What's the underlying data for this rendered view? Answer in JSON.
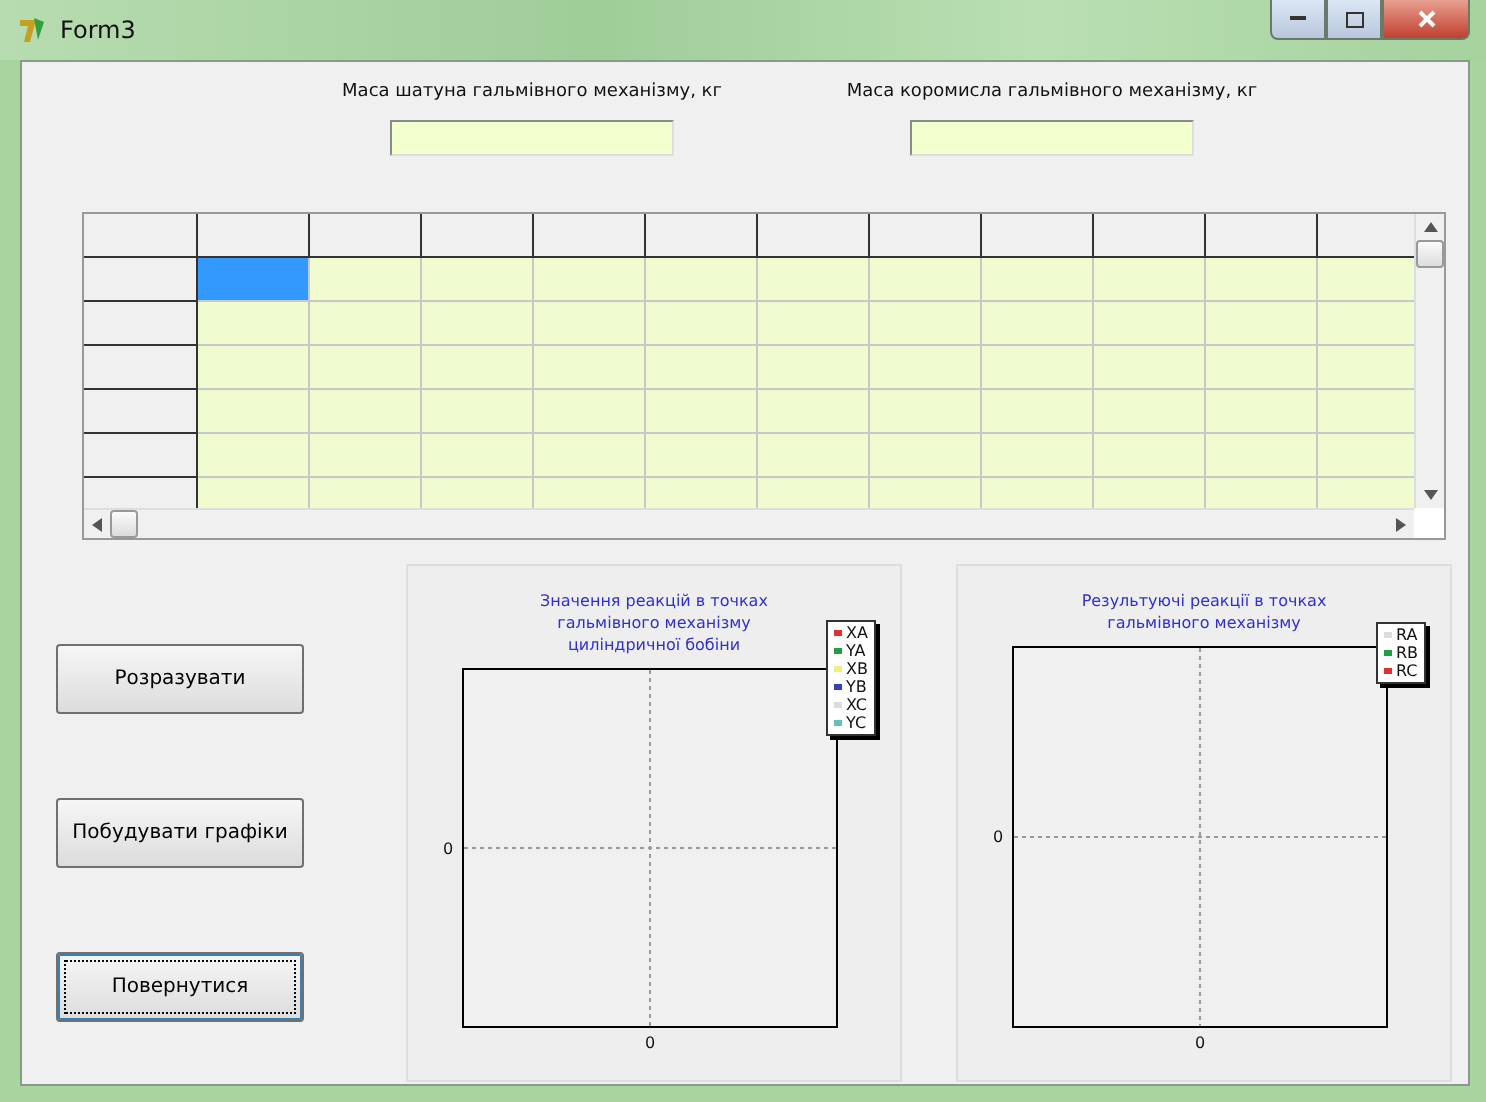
{
  "window": {
    "title": "Form3"
  },
  "fields": [
    {
      "label": "Маса шатуна гальмівного механізму, кг"
    },
    {
      "label": "Маса коромисла гальмівного механізму, кг"
    }
  ],
  "grid": {
    "header_cells": [
      {
        "selected": false
      },
      {
        "selected": false
      },
      {
        "selected": false
      },
      {
        "selected": false
      },
      {
        "selected": false
      },
      {
        "selected": false
      },
      {
        "selected": false
      },
      {
        "selected": false
      },
      {
        "selected": false
      },
      {
        "selected": false
      },
      {
        "selected": false
      }
    ],
    "rows": [
      {
        "cells": [
          {
            "selected": true
          },
          {
            "selected": false
          },
          {
            "selected": false
          },
          {
            "selected": false
          },
          {
            "selected": false
          },
          {
            "selected": false
          },
          {
            "selected": false
          },
          {
            "selected": false
          },
          {
            "selected": false
          },
          {
            "selected": false
          },
          {
            "selected": false
          }
        ]
      },
      {
        "cells": [
          {
            "selected": false
          },
          {
            "selected": false
          },
          {
            "selected": false
          },
          {
            "selected": false
          },
          {
            "selected": false
          },
          {
            "selected": false
          },
          {
            "selected": false
          },
          {
            "selected": false
          },
          {
            "selected": false
          },
          {
            "selected": false
          },
          {
            "selected": false
          }
        ]
      },
      {
        "cells": [
          {
            "selected": false
          },
          {
            "selected": false
          },
          {
            "selected": false
          },
          {
            "selected": false
          },
          {
            "selected": false
          },
          {
            "selected": false
          },
          {
            "selected": false
          },
          {
            "selected": false
          },
          {
            "selected": false
          },
          {
            "selected": false
          },
          {
            "selected": false
          }
        ]
      },
      {
        "cells": [
          {
            "selected": false
          },
          {
            "selected": false
          },
          {
            "selected": false
          },
          {
            "selected": false
          },
          {
            "selected": false
          },
          {
            "selected": false
          },
          {
            "selected": false
          },
          {
            "selected": false
          },
          {
            "selected": false
          },
          {
            "selected": false
          },
          {
            "selected": false
          }
        ]
      },
      {
        "cells": [
          {
            "selected": false
          },
          {
            "selected": false
          },
          {
            "selected": false
          },
          {
            "selected": false
          },
          {
            "selected": false
          },
          {
            "selected": false
          },
          {
            "selected": false
          },
          {
            "selected": false
          },
          {
            "selected": false
          },
          {
            "selected": false
          },
          {
            "selected": false
          }
        ]
      },
      {
        "cells": [
          {
            "selected": false
          },
          {
            "selected": false
          },
          {
            "selected": false
          },
          {
            "selected": false
          },
          {
            "selected": false
          },
          {
            "selected": false
          },
          {
            "selected": false
          },
          {
            "selected": false
          },
          {
            "selected": false
          },
          {
            "selected": false
          },
          {
            "selected": false
          }
        ]
      }
    ]
  },
  "buttons": [
    {
      "label": "Розразувати",
      "focused": false
    },
    {
      "label": "Побудувати графіки",
      "focused": false
    },
    {
      "label": "Повернутися",
      "focused": true
    }
  ],
  "charts": [
    {
      "title": "Значення реакцій в точках гальмівного механізму циліндричної бобіни",
      "y_tick": "0",
      "x_tick": "0",
      "legend": [
        {
          "label": "XA",
          "color": "#e03030"
        },
        {
          "label": "YA",
          "color": "#20a040"
        },
        {
          "label": "XB",
          "color": "#f0f080"
        },
        {
          "label": "YB",
          "color": "#3040c0"
        },
        {
          "label": "XC",
          "color": "#dcdcdc"
        },
        {
          "label": "YC",
          "color": "#60c0c0"
        }
      ]
    },
    {
      "title": "Результуючі реакції в точках гальмівного механізму",
      "y_tick": "0",
      "x_tick": "0",
      "legend": [
        {
          "label": "RA",
          "color": "#dcdcdc"
        },
        {
          "label": "RB",
          "color": "#20a040"
        },
        {
          "label": "RC",
          "color": "#e03030"
        }
      ]
    }
  ]
}
